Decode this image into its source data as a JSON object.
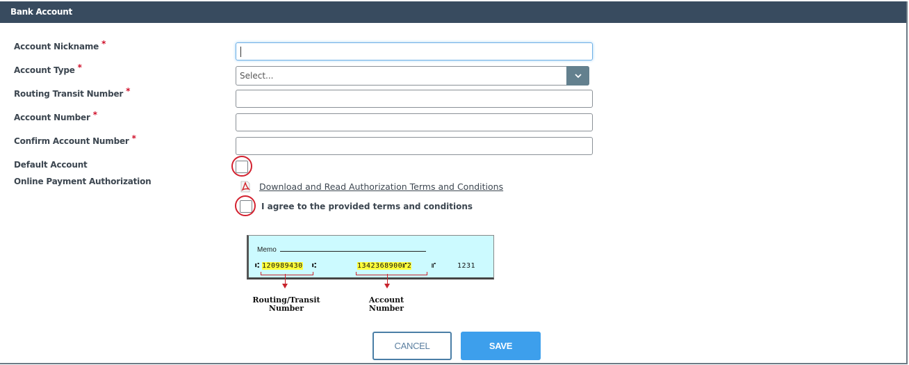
{
  "header": {
    "title": "Bank Account"
  },
  "form": {
    "required_marker": "*",
    "fields": [
      {
        "label": "Account Nickname",
        "required": true,
        "value": "",
        "focused": true
      },
      {
        "label": "Account Type",
        "required": true,
        "type": "select",
        "value": "Select..."
      },
      {
        "label": "Routing Transit Number",
        "required": true,
        "value": ""
      },
      {
        "label": "Account Number",
        "required": true,
        "value": ""
      },
      {
        "label": "Confirm Account Number",
        "required": true,
        "value": ""
      }
    ],
    "default_account": {
      "label": "Default Account",
      "checked": false
    },
    "authorization": {
      "label": "Online Payment Authorization",
      "link_text": "Download and Read Authorization Terms and Conditions",
      "agree_label": "I agree to the provided terms and conditions",
      "agree_checked": false
    }
  },
  "check_diagram": {
    "memo_label": "Memo",
    "routing_micr": "120989430",
    "account_micr": "1342368900",
    "account_suffix": "2",
    "check_number": "1231",
    "routing_caption_line1": "Routing/Transit",
    "routing_caption_line2": "Number",
    "account_caption_line1": "Account",
    "account_caption_line2": "Number"
  },
  "buttons": {
    "cancel": "CANCEL",
    "save": "SAVE"
  },
  "colors": {
    "header_bg": "#384b5f",
    "required": "#d0102a",
    "save_bg": "#3d9fec",
    "highlight_ring": "#d3212f"
  }
}
